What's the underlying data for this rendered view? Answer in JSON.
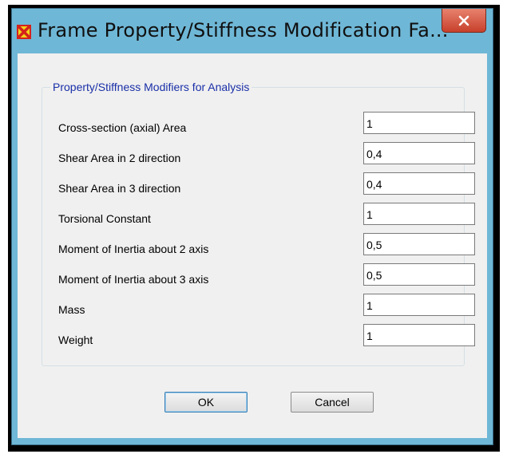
{
  "window": {
    "title": "Frame Property/Stiffness Modification Fa...",
    "close_glyph": "✕",
    "app_icon": "sap-frame-icon",
    "colors": {
      "titlebar": "#6fb7d6",
      "close": "#c7402b",
      "group_title": "#1a2fa8"
    }
  },
  "group": {
    "title": "Property/Stiffness Modifiers for Analysis",
    "rows": [
      {
        "label": "Cross-section (axial) Area",
        "value": "1"
      },
      {
        "label": "Shear Area in 2 direction",
        "value": "0,4"
      },
      {
        "label": "Shear Area in 3 direction",
        "value": "0,4"
      },
      {
        "label": "Torsional Constant",
        "value": "1"
      },
      {
        "label": "Moment of Inertia about 2 axis",
        "value": "0,5"
      },
      {
        "label": "Moment of Inertia about 3 axis",
        "value": "0,5"
      },
      {
        "label": "Mass",
        "value": "1"
      },
      {
        "label": "Weight",
        "value": "1"
      }
    ]
  },
  "buttons": {
    "ok": "OK",
    "cancel": "Cancel"
  }
}
